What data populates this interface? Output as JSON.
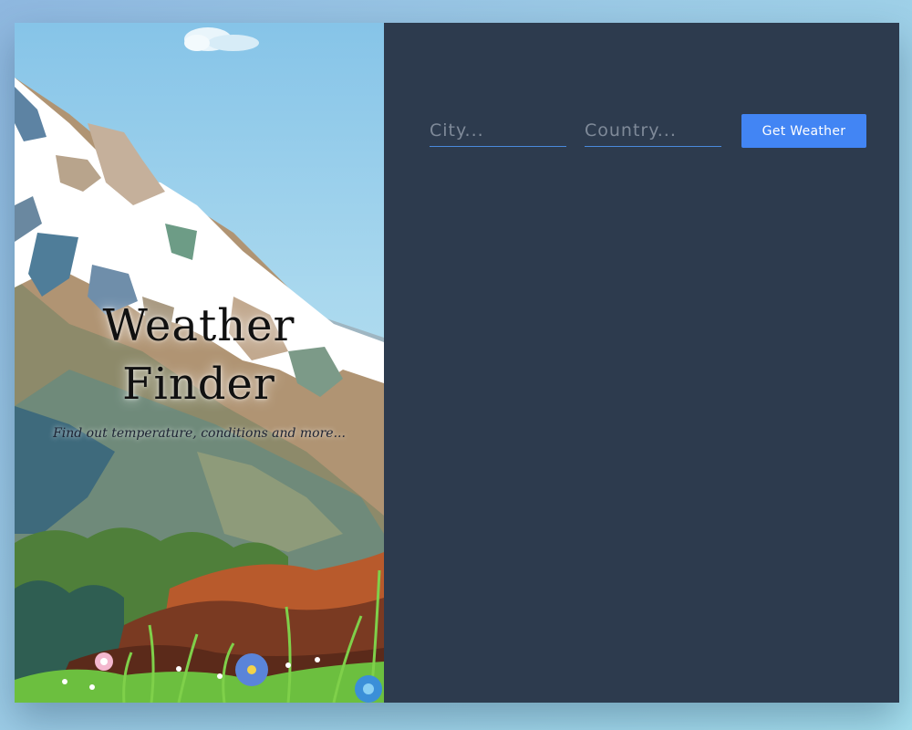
{
  "hero": {
    "title": "Weather Finder",
    "subtitle": "Find out temperature, conditions and more..."
  },
  "form": {
    "city_placeholder": "City...",
    "city_value": "",
    "country_placeholder": "Country...",
    "country_value": "",
    "submit_label": "Get Weather"
  },
  "colors": {
    "panel_background": "#2d3b4e",
    "accent": "#4285f4",
    "input_underline": "#4a89dc"
  }
}
